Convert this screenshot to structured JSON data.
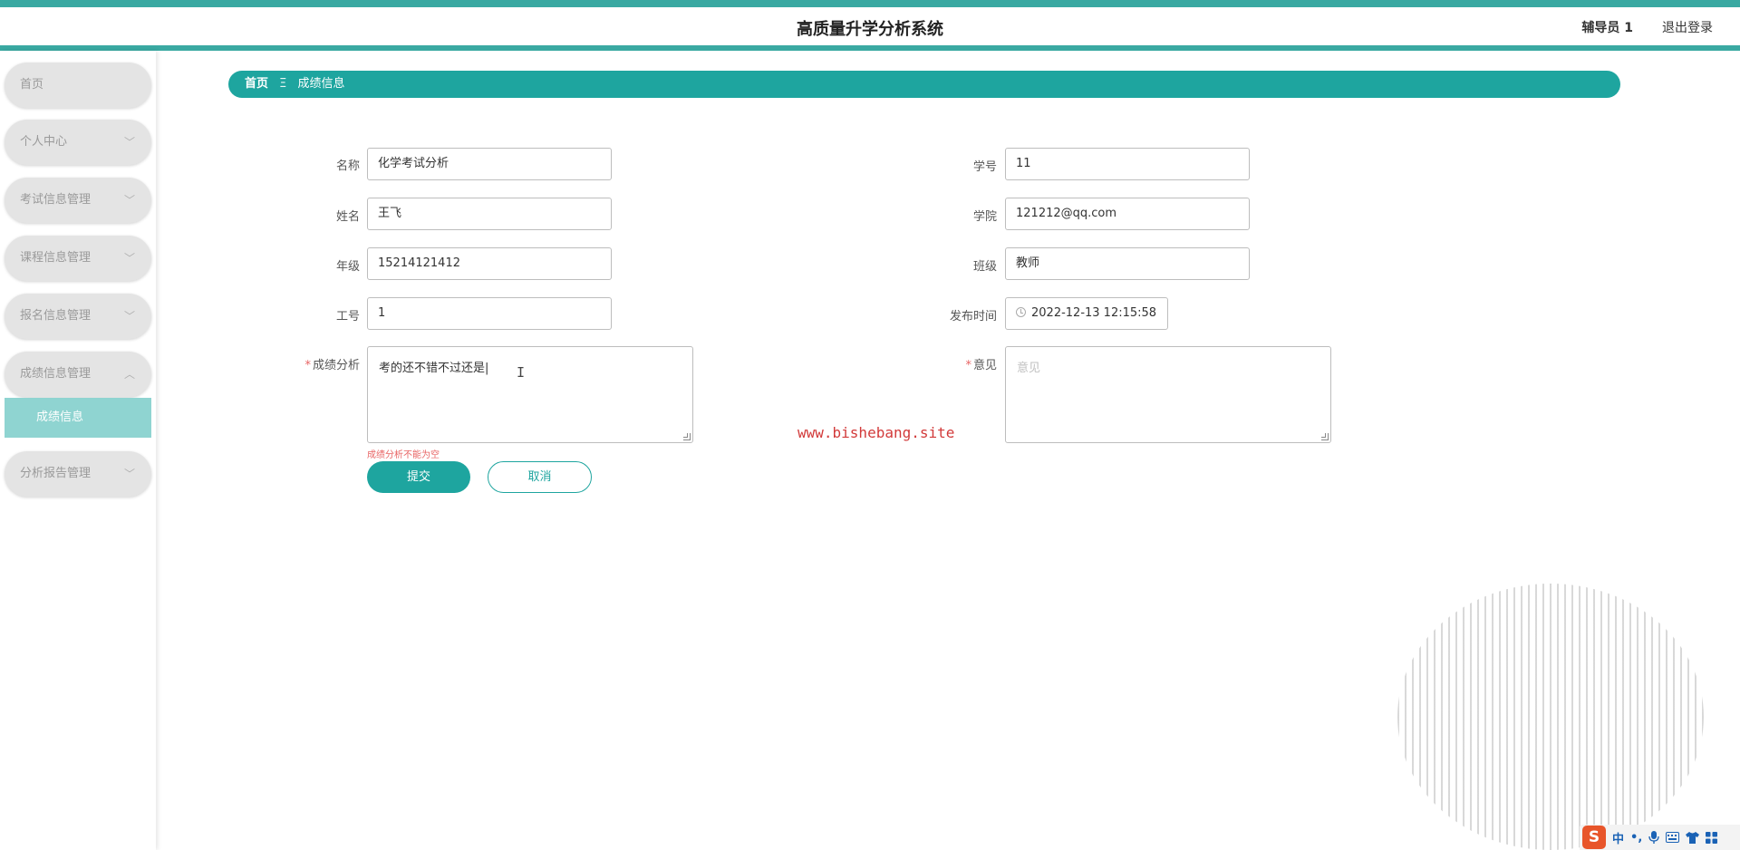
{
  "header": {
    "title": "高质量升学分析系统",
    "user": "辅导员 1",
    "logout": "退出登录"
  },
  "sidebar": {
    "items": [
      {
        "label": "首页"
      },
      {
        "label": "个人中心",
        "chevron": "chevron-down-icon"
      },
      {
        "label": "考试信息管理",
        "chevron": "chevron-down-icon"
      },
      {
        "label": "课程信息管理",
        "chevron": "chevron-down-icon"
      },
      {
        "label": "报名信息管理",
        "chevron": "chevron-down-icon"
      },
      {
        "label": "成绩信息管理",
        "chevron": "chevron-up-icon"
      },
      {
        "label": "分析报告管理",
        "chevron": "chevron-down-icon"
      }
    ],
    "subitem": "成绩信息"
  },
  "breadcrumb": {
    "home": "首页",
    "separator": "Ξ",
    "current": "成绩信息"
  },
  "form": {
    "name_label": "名称",
    "name_value": "化学考试分析",
    "student_no_label": "学号",
    "student_no_value": "11",
    "full_name_label": "姓名",
    "full_name_value": "王飞",
    "college_label": "学院",
    "college_value": "121212@qq.com",
    "grade_label": "年级",
    "grade_value": "15214121412",
    "class_label": "班级",
    "class_value": "教师",
    "job_no_label": "工号",
    "job_no_value": "1",
    "publish_time_label": "发布时间",
    "publish_time_value": "2022-12-13 12:15:58",
    "analysis_label": "成绩分析",
    "analysis_value": "考的还不错不过还是|",
    "opinion_label": "意见",
    "opinion_placeholder": "意见",
    "required_mark": "*",
    "analysis_error": "成绩分析不能为空",
    "submit": "提交",
    "cancel": "取消"
  },
  "watermark": "www.bishebang.site",
  "ime": {
    "logo": "S",
    "mode": "中",
    "punct": "•,"
  },
  "colors": {
    "accent": "#1ea59f",
    "header_border": "#3aa9a2",
    "submenu_bg": "#8fd4d1",
    "error": "#e86464"
  }
}
